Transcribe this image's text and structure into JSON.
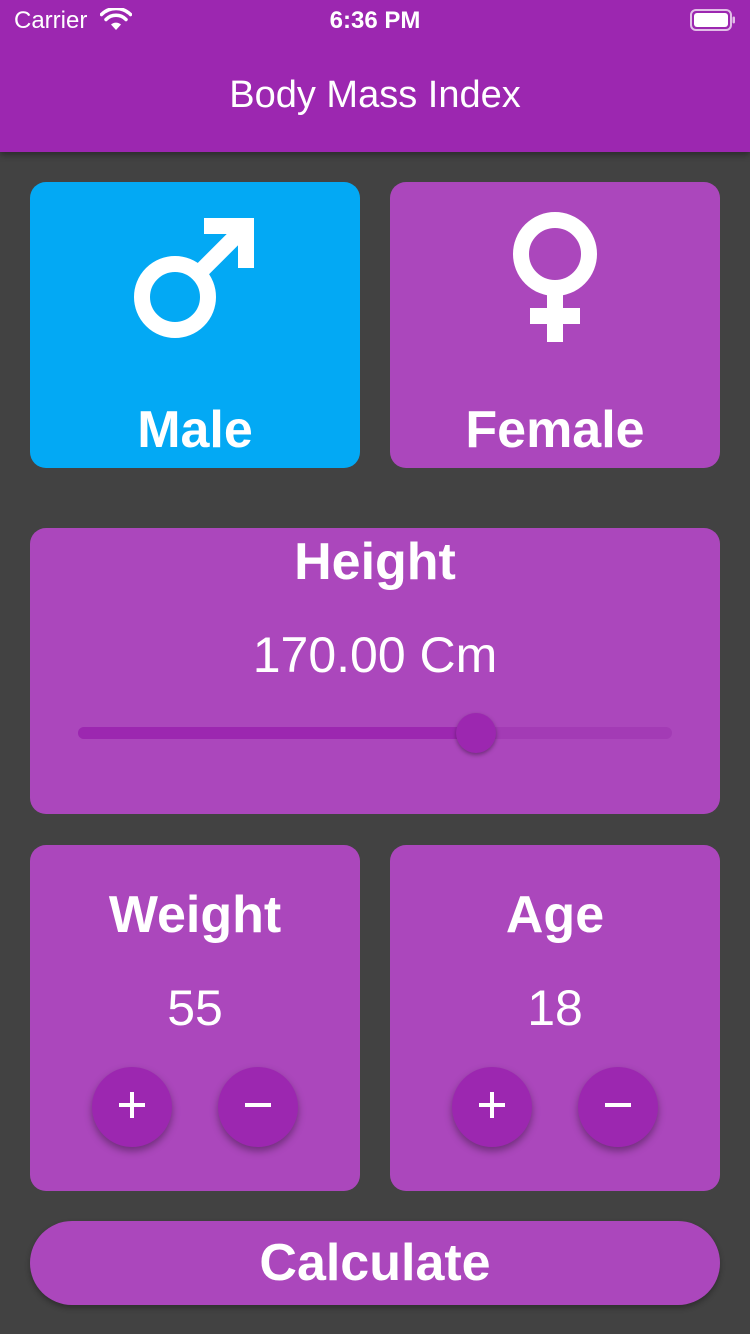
{
  "status_bar": {
    "carrier": "Carrier",
    "time": "6:36 PM",
    "icons": [
      "wifi-icon",
      "battery-icon"
    ]
  },
  "app_bar": {
    "title": "Body Mass Index"
  },
  "gender": {
    "male": {
      "label": "Male",
      "icon": "male-icon",
      "selected": true
    },
    "female": {
      "label": "Female",
      "icon": "female-icon",
      "selected": false
    }
  },
  "height": {
    "title": "Height",
    "value_text": "170.00 Cm",
    "slider_fraction": 0.67
  },
  "weight": {
    "title": "Weight",
    "value": "55",
    "plus_icon": "plus-icon",
    "minus_icon": "minus-icon"
  },
  "age": {
    "title": "Age",
    "value": "18",
    "plus_icon": "plus-icon",
    "minus_icon": "minus-icon"
  },
  "calculate": {
    "label": "Calculate"
  },
  "colors": {
    "primary": "#9c27b0",
    "card": "#ab47bc",
    "selected": "#03a9f4",
    "background": "#424242"
  }
}
